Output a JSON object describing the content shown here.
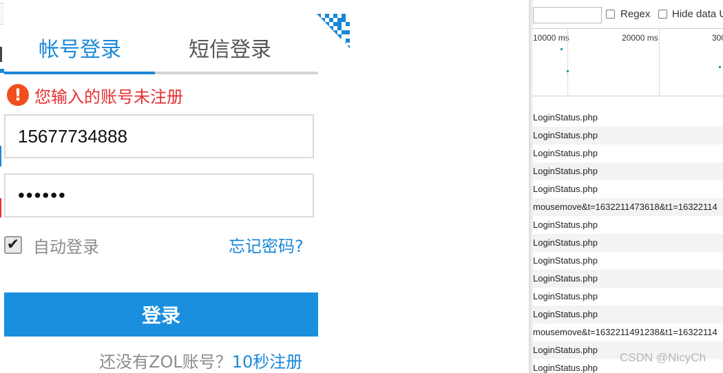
{
  "login": {
    "tabs": [
      {
        "label": "帐号登录",
        "active": true
      },
      {
        "label": "短信登录",
        "active": false
      }
    ],
    "error_message": "您输入的账号未注册",
    "error_icon": "exclamation-circle-icon",
    "username_value": "15677734888",
    "password_value": "••••••",
    "remember_label": "自动登录",
    "remember_checked": true,
    "forgot_label": "忘记密码?",
    "submit_label": "登录",
    "register_prompt": "还没有ZOL账号？",
    "register_link": "10秒注册",
    "qr_icon": "qr-code-corner-icon",
    "colors": {
      "accent": "#1a88d8",
      "error": "#e53030",
      "button": "#1a8fde"
    }
  },
  "devtools": {
    "filter_value": "",
    "regex_label": "Regex",
    "hide_data_label": "Hide data U",
    "timeline_ticks": [
      "10000 ms",
      "20000 ms",
      "300"
    ],
    "requests": [
      "LoginStatus.php",
      "LoginStatus.php",
      "LoginStatus.php",
      "LoginStatus.php",
      "LoginStatus.php",
      "mousemove&t=1632211473618&t1=16322114",
      "LoginStatus.php",
      "LoginStatus.php",
      "LoginStatus.php",
      "LoginStatus.php",
      "LoginStatus.php",
      "LoginStatus.php",
      "mousemove&t=1632211491238&t1=16322114",
      "LoginStatus.php",
      "LoginStatus.php"
    ]
  },
  "watermark": "CSDN @NicyCh"
}
